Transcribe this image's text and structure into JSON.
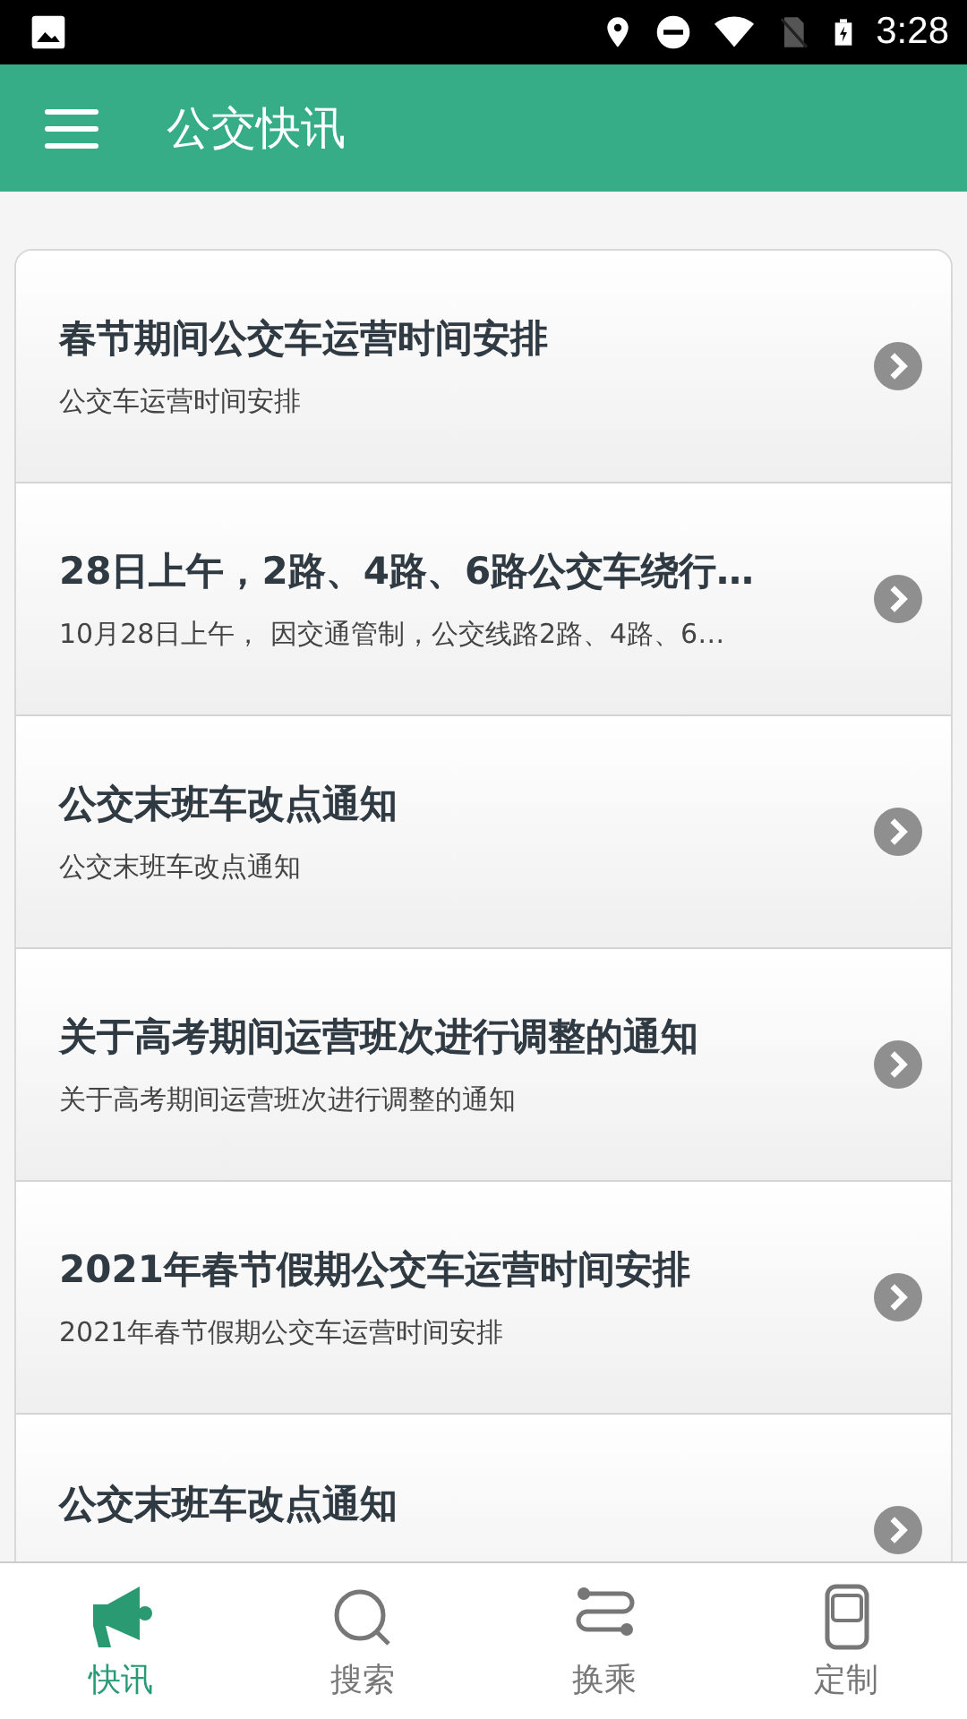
{
  "status_bar": {
    "time": "3:28"
  },
  "app_bar": {
    "title": "公交快讯"
  },
  "news": [
    {
      "title": "春节期间公交车运营时间安排",
      "summary": "公交车运营时间安排"
    },
    {
      "title": "28日上午，2路、4路、6路公交车绕行…",
      "summary": "10月28日上午， 因交通管制，公交线路2路、4路、6…"
    },
    {
      "title": "公交末班车改点通知",
      "summary": "公交末班车改点通知"
    },
    {
      "title": "关于高考期间运营班次进行调整的通知",
      "summary": "关于高考期间运营班次进行调整的通知"
    },
    {
      "title": "2021年春节假期公交车运营时间安排",
      "summary": "2021年春节假期公交车运营时间安排"
    },
    {
      "title": "公交末班车改点通知"
    }
  ],
  "bottom_nav": [
    {
      "label": "快讯",
      "kind": "megaphone",
      "selected": true
    },
    {
      "label": "搜索",
      "kind": "search",
      "selected": false
    },
    {
      "label": "换乘",
      "kind": "route",
      "selected": false
    },
    {
      "label": "定制",
      "kind": "bus",
      "selected": false
    }
  ]
}
